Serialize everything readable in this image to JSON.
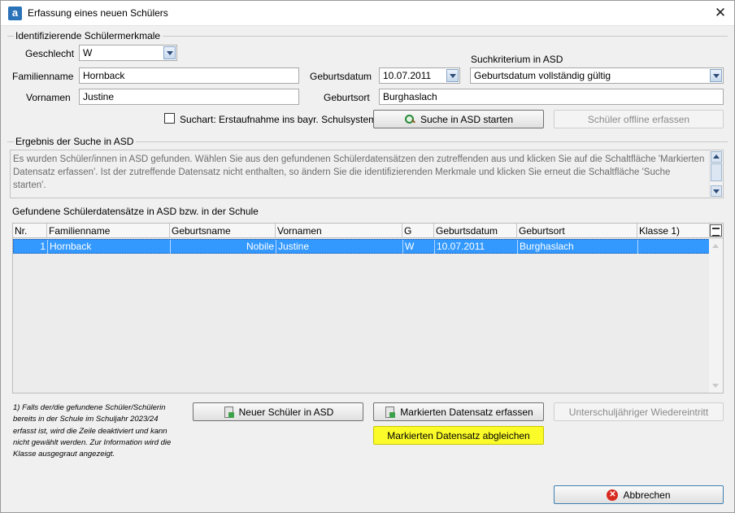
{
  "window": {
    "app_icon_letter": "a",
    "title": "Erfassung eines neuen Schülers",
    "close_glyph": "✕"
  },
  "identifying": {
    "group_title": "Identifizierende Schülermerkmale",
    "geschlecht_label": "Geschlecht",
    "geschlecht_value": "W",
    "familienname_label": "Familienname",
    "familienname_value": "Hornback",
    "vornamen_label": "Vornamen",
    "vornamen_value": "Justine",
    "geburtsdatum_label": "Geburtsdatum",
    "geburtsdatum_value": "10.07.2011",
    "geburtsort_label": "Geburtsort",
    "geburtsort_value": "Burghaslach",
    "suchkriterium_label": "Suchkriterium in ASD",
    "suchkriterium_value": "Geburtsdatum vollständig gültig",
    "suchart_label": "Suchart: Erstaufnahme ins bayr. Schulsystem",
    "suchart_checked": false,
    "search_button": "Suche in ASD starten",
    "offline_button": "Schüler offline erfassen"
  },
  "result": {
    "group_title": "Ergebnis der Suche in ASD",
    "text": "Es wurden Schüler/innen in ASD gefunden. Wählen Sie aus den gefundenen Schülerdatensätzen den zutreffenden aus und klicken Sie auf die Schaltfläche 'Markierten Datensatz erfassen'. Ist der zutreffende Datensatz nicht enthalten, so ändern Sie die identifizierenden Merkmale und klicken Sie erneut die Schaltfläche 'Suche starten'."
  },
  "table": {
    "title": "Gefundene Schülerdatensätze in ASD bzw. in der Schule",
    "headers": [
      "Nr.",
      "Familienname",
      "Geburtsname",
      "Vornamen",
      "G",
      "Geburtsdatum",
      "Geburtsort",
      "Klasse 1)"
    ],
    "rows": [
      [
        "1",
        "Hornback",
        "Nobile",
        "Justine",
        "W",
        "10.07.2011",
        "Burghaslach",
        ""
      ]
    ]
  },
  "footnote": "1) Falls der/die gefundene Schüler/Schülerin bereits in der Schule im Schuljahr 2023/24 erfasst ist, wird die Zeile deaktiviert und kann nicht gewählt werden. Zur Information wird die Klasse ausgegraut angezeigt.",
  "buttons": {
    "neuer_schueler": "Neuer Schüler in ASD",
    "markierten_erfassen": "Markierten Datensatz erfassen",
    "unterschul": "Unterschuljähriger Wiedereintritt",
    "abgleichen": "Markierten Datensatz abgleichen",
    "abbrechen": "Abbrechen"
  },
  "colors": {
    "selection": "#3399ff",
    "highlight": "#fbfb2a",
    "cancel_icon": "#d82a20"
  }
}
